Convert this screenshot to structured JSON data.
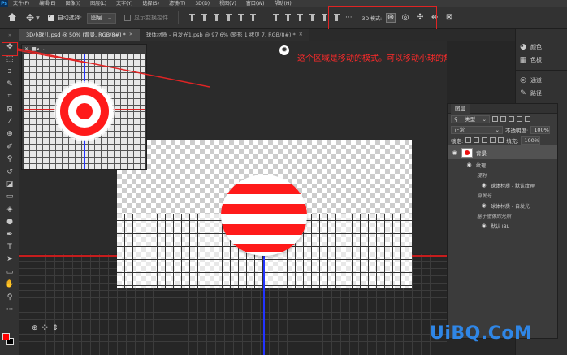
{
  "menubar": {
    "logo": "Ps",
    "items": [
      "文件(F)",
      "编辑(E)",
      "图像(I)",
      "图层(L)",
      "文字(Y)",
      "选择(S)",
      "滤镜(T)",
      "3D(D)",
      "视图(V)",
      "窗口(W)",
      "帮助(H)"
    ]
  },
  "options": {
    "auto_select_label": "自动选择:",
    "auto_select_value": "图层",
    "show_transform_label": "显示变换控件",
    "mode_label": "3D 模式:",
    "mode_icons": [
      "orbit-3d-icon",
      "roll-3d-icon",
      "pan-3d-icon",
      "slide-3d-icon",
      "scale-3d-icon"
    ]
  },
  "tabs": [
    {
      "label": "3D小球儿.psd @ 50% (背景, RGB/8#) *",
      "active": true
    },
    {
      "label": "球体材质 - 自发光1.psb @ 97.6% (矩形 1 拷贝 7, RGB/8#) *",
      "active": false
    }
  ],
  "annotation": "这个区域是移动的模式。可以移动小球的角度等",
  "right_panel": {
    "items": [
      {
        "icon": "palette-icon",
        "label": "颜色"
      },
      {
        "icon": "swatches-icon",
        "label": "色板"
      },
      {
        "icon": "channels-icon",
        "label": "通道"
      },
      {
        "icon": "paths-icon",
        "label": "路径"
      }
    ]
  },
  "layers_panel": {
    "tab": "图层",
    "filter_label": "类型",
    "blend_mode": "正常",
    "opacity_label": "不透明度:",
    "opacity_value": "100%",
    "lock_label": "锁定:",
    "fill_label": "填充:",
    "fill_value": "100%",
    "layers": [
      {
        "name": "背景",
        "type": "layer"
      },
      {
        "name": "纹理",
        "type": "group"
      },
      {
        "name": "漫射",
        "type": "category"
      },
      {
        "name": "球体材质 - 默认纹理",
        "type": "texture"
      },
      {
        "name": "自发光",
        "type": "category"
      },
      {
        "name": "球体材质 - 自发光",
        "type": "texture"
      },
      {
        "name": "基于图像的光照",
        "type": "category"
      },
      {
        "name": "默认 IBL",
        "type": "texture"
      }
    ]
  },
  "watermark": "UiBQ.CoM",
  "colors": {
    "foreground": "#ff0000",
    "background": "#000000",
    "highlight": "#e02424",
    "ball_stripe": "#ff1a1a"
  }
}
